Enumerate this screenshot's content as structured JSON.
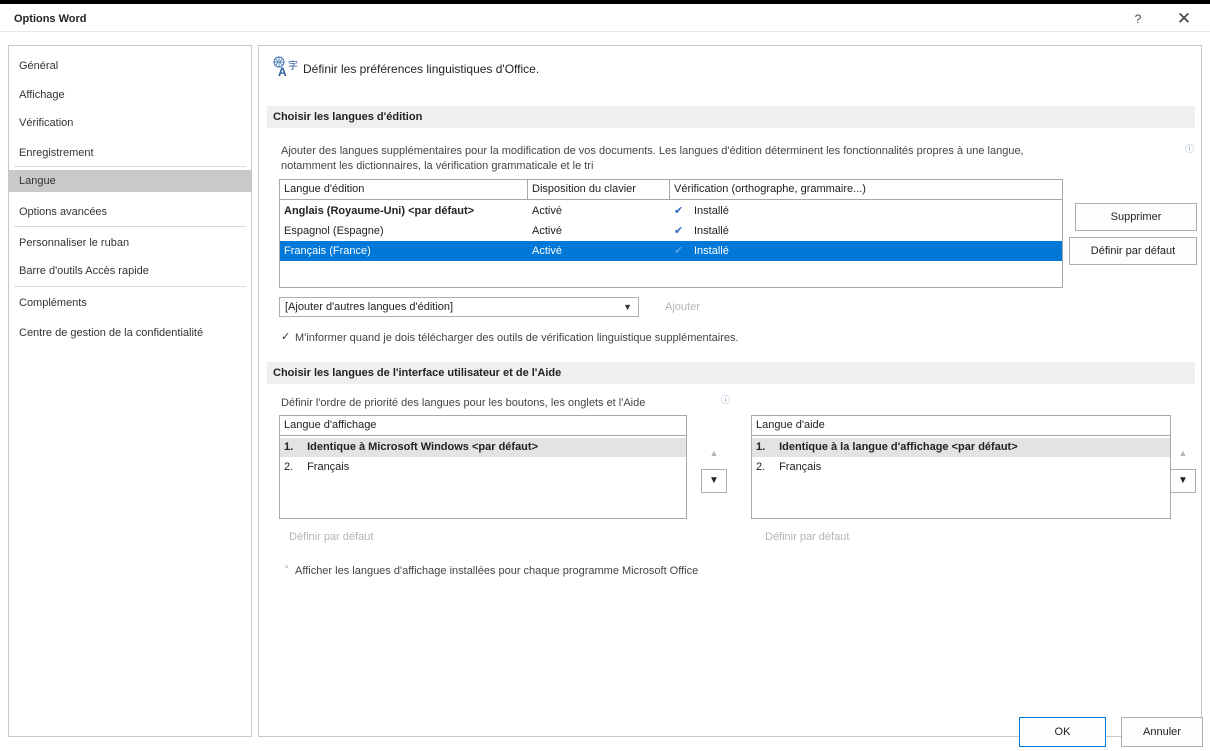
{
  "window": {
    "title": "Options Word",
    "help_label": "?",
    "close_label": "✕"
  },
  "sidebar": {
    "items": [
      {
        "label": "Général"
      },
      {
        "label": "Affichage"
      },
      {
        "label": "Vérification"
      },
      {
        "label": "Enregistrement"
      },
      {
        "label": "Langue"
      },
      {
        "label": "Options avancées"
      },
      {
        "label": "Personnaliser le ruban"
      },
      {
        "label": "Barre d'outils Accès rapide"
      },
      {
        "label": "Compléments"
      },
      {
        "label": "Centre de gestion de la confidentialité"
      }
    ],
    "selected": "Langue"
  },
  "page": {
    "heading": "Définir les préférences linguistiques d'Office."
  },
  "editing": {
    "section_title": "Choisir les langues d'édition",
    "description_line1": "Ajouter des langues supplémentaires pour la modification de vos documents. Les langues d'édition déterminent les fonctionnalités propres à une langue,",
    "description_line2": "notamment les dictionnaires, la vérification grammaticale et le tri",
    "columns": [
      "Langue d'édition",
      "Disposition du clavier",
      "Vérification (orthographe, grammaire...)"
    ],
    "rows": [
      {
        "language": "Anglais (Royaume-Uni) <par défaut>",
        "keyboard": "Activé",
        "proofing": "Installé",
        "bold": true,
        "selected": false
      },
      {
        "language": "Espagnol (Espagne)",
        "keyboard": "Activé",
        "proofing": "Installé",
        "bold": false,
        "selected": false
      },
      {
        "language": "Français (France)",
        "keyboard": "Activé",
        "proofing": "Installé",
        "bold": false,
        "selected": true
      }
    ],
    "remove_button": "Supprimer",
    "default_button": "Définir par défaut",
    "add_combo": "[Ajouter d'autres langues d'édition]",
    "add_button": "Ajouter",
    "notify_checkbox": "M'informer quand je dois télécharger des outils de vérification linguistique supplémentaires.",
    "notify_checked": true
  },
  "interface": {
    "section_title": "Choisir les langues de l'interface utilisateur et de l'Aide",
    "description": "Définir l'ordre de priorité des langues pour les boutons, les onglets et l'Aide",
    "display": {
      "header": "Langue d'affichage",
      "items": [
        {
          "num": "1.",
          "label": "Identique à Microsoft Windows <par défaut>"
        },
        {
          "num": "2.",
          "label": "Français"
        }
      ],
      "default_link": "Définir par défaut"
    },
    "help": {
      "header": "Langue d'aide",
      "items": [
        {
          "num": "1.",
          "label": "Identique à la langue d'affichage <par défaut>"
        },
        {
          "num": "2.",
          "label": "Français"
        }
      ],
      "default_link": "Définir par défaut"
    },
    "show_installed": "Afficher les langues d'affichage installées pour chaque programme Microsoft Office"
  },
  "footer": {
    "ok": "OK",
    "cancel": "Annuler"
  },
  "colors": {
    "selection": "#0078d7",
    "section_bg": "#efefef",
    "sidebar_selected": "#c9c9c9"
  }
}
